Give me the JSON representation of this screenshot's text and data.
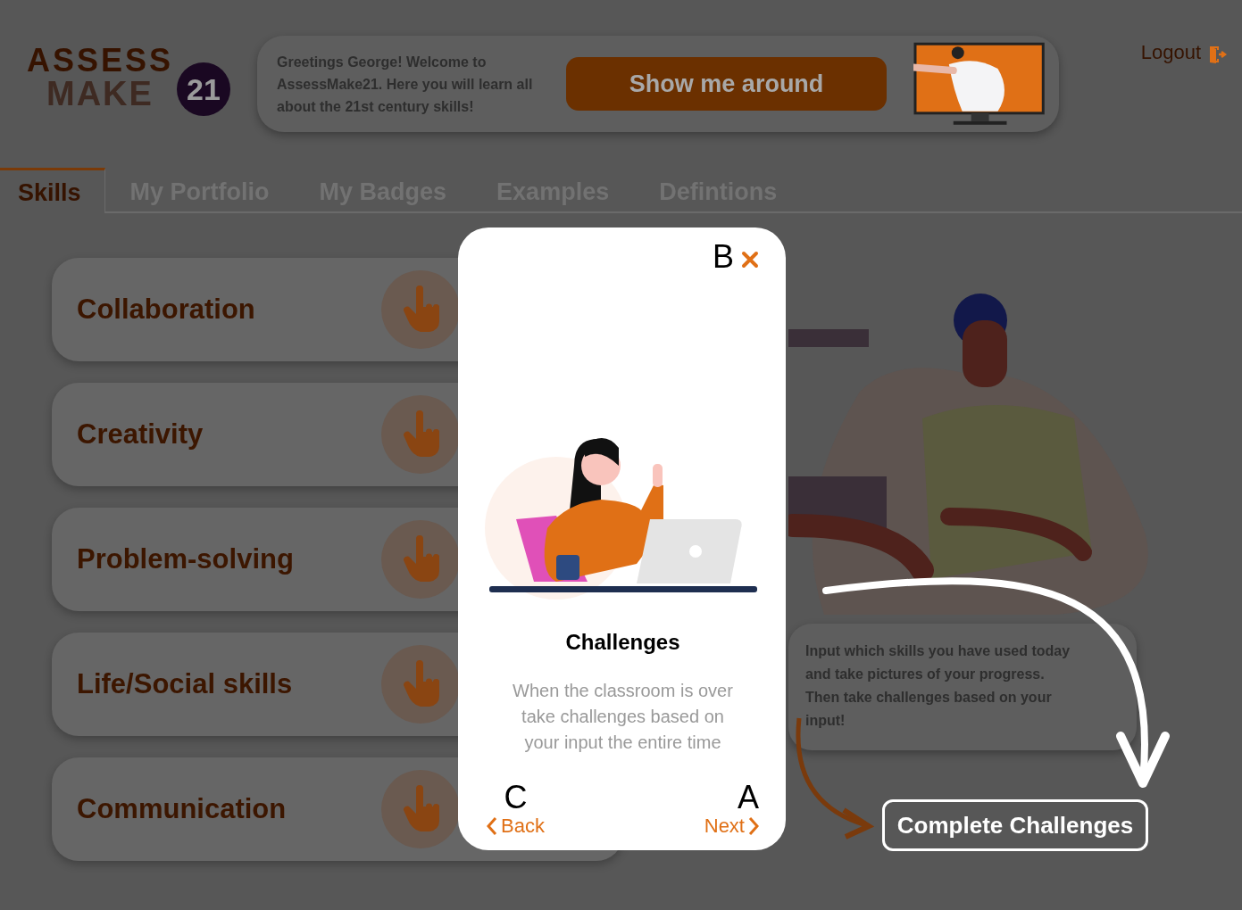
{
  "logo": {
    "line_1": "ASSESS",
    "line_2": "MAKE",
    "badge": "21"
  },
  "welcome": {
    "message": "Greetings George! Welcome to AssessMake21. Here you will learn all about the 21st century skills!",
    "button": "Show me around"
  },
  "logout": "Logout",
  "tabs": [
    {
      "label": "Skills",
      "selected": true
    },
    {
      "label": "My Portfolio",
      "selected": false
    },
    {
      "label": "My Badges",
      "selected": false
    },
    {
      "label": "Examples",
      "selected": false
    },
    {
      "label": "Defintions",
      "selected": false
    }
  ],
  "skills": [
    "Collaboration",
    "Creativity",
    "Problem-solving",
    "Life/Social skills",
    "Communication"
  ],
  "help_bubble": "Input which skills you have used today and take pictures of your progress. Then take challenges based on your input!",
  "complete_button": "Complete Challenges",
  "tour": {
    "title": "Challenges",
    "text": "When the classroom is over take challenges based on your input the entire time",
    "back": "Back",
    "next": "Next",
    "marker_close": "B",
    "marker_back": "C",
    "marker_next": "A"
  }
}
